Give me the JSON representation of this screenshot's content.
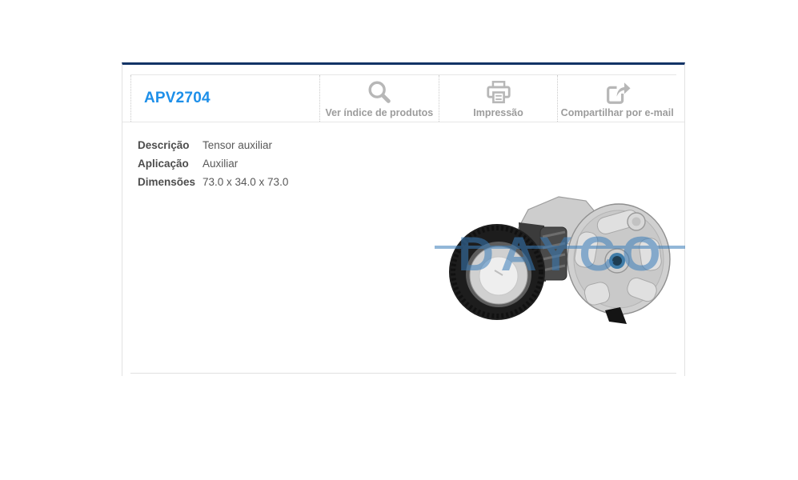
{
  "colors": {
    "navy_bar": "#123366",
    "part_number_blue": "#1d8fe9",
    "action_icon_gray": "#b7b7b7",
    "action_label_gray": "#9c9c9c",
    "hairline_gray": "#e6e6e6",
    "watermark_blue": "#3a7dba"
  },
  "header": {
    "part_number": "APV2704",
    "actions": [
      {
        "icon": "search-icon",
        "label": "Ver índice de produtos"
      },
      {
        "icon": "printer-icon",
        "label": "Impressão"
      },
      {
        "icon": "share-icon",
        "label": "Compartilhar por e-mail"
      }
    ]
  },
  "details": {
    "rows": [
      {
        "label": "Descrição",
        "value": "Tensor auxiliar"
      },
      {
        "label": "Aplicação",
        "value": "Auxiliar"
      },
      {
        "label": "Dimensões",
        "value": "73.0 x 34.0 x 73.0"
      }
    ]
  },
  "product": {
    "watermark": "DAYCO"
  }
}
